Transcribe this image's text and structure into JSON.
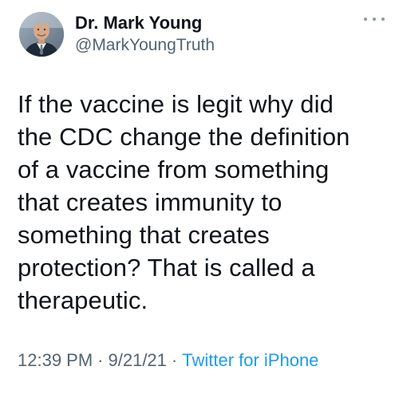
{
  "tweet": {
    "author": {
      "display_name": "Dr. Mark Young",
      "handle": "@MarkYoungTruth",
      "avatar_icon": "profile-photo"
    },
    "more_icon": "more-dots-icon",
    "text": "If the vaccine is legit why did\nthe CDC change the  definition\nof a vaccine from something\nthat creates immunity to\nsomething that creates\nprotection? That is called a\ntherapeutic.",
    "time": "12:39 PM",
    "separator": "·",
    "date": "9/21/21",
    "source": "Twitter for iPhone"
  },
  "colors": {
    "text": "#0f1419",
    "secondary": "#536471",
    "link": "#1d9bf0",
    "background": "#ffffff"
  }
}
